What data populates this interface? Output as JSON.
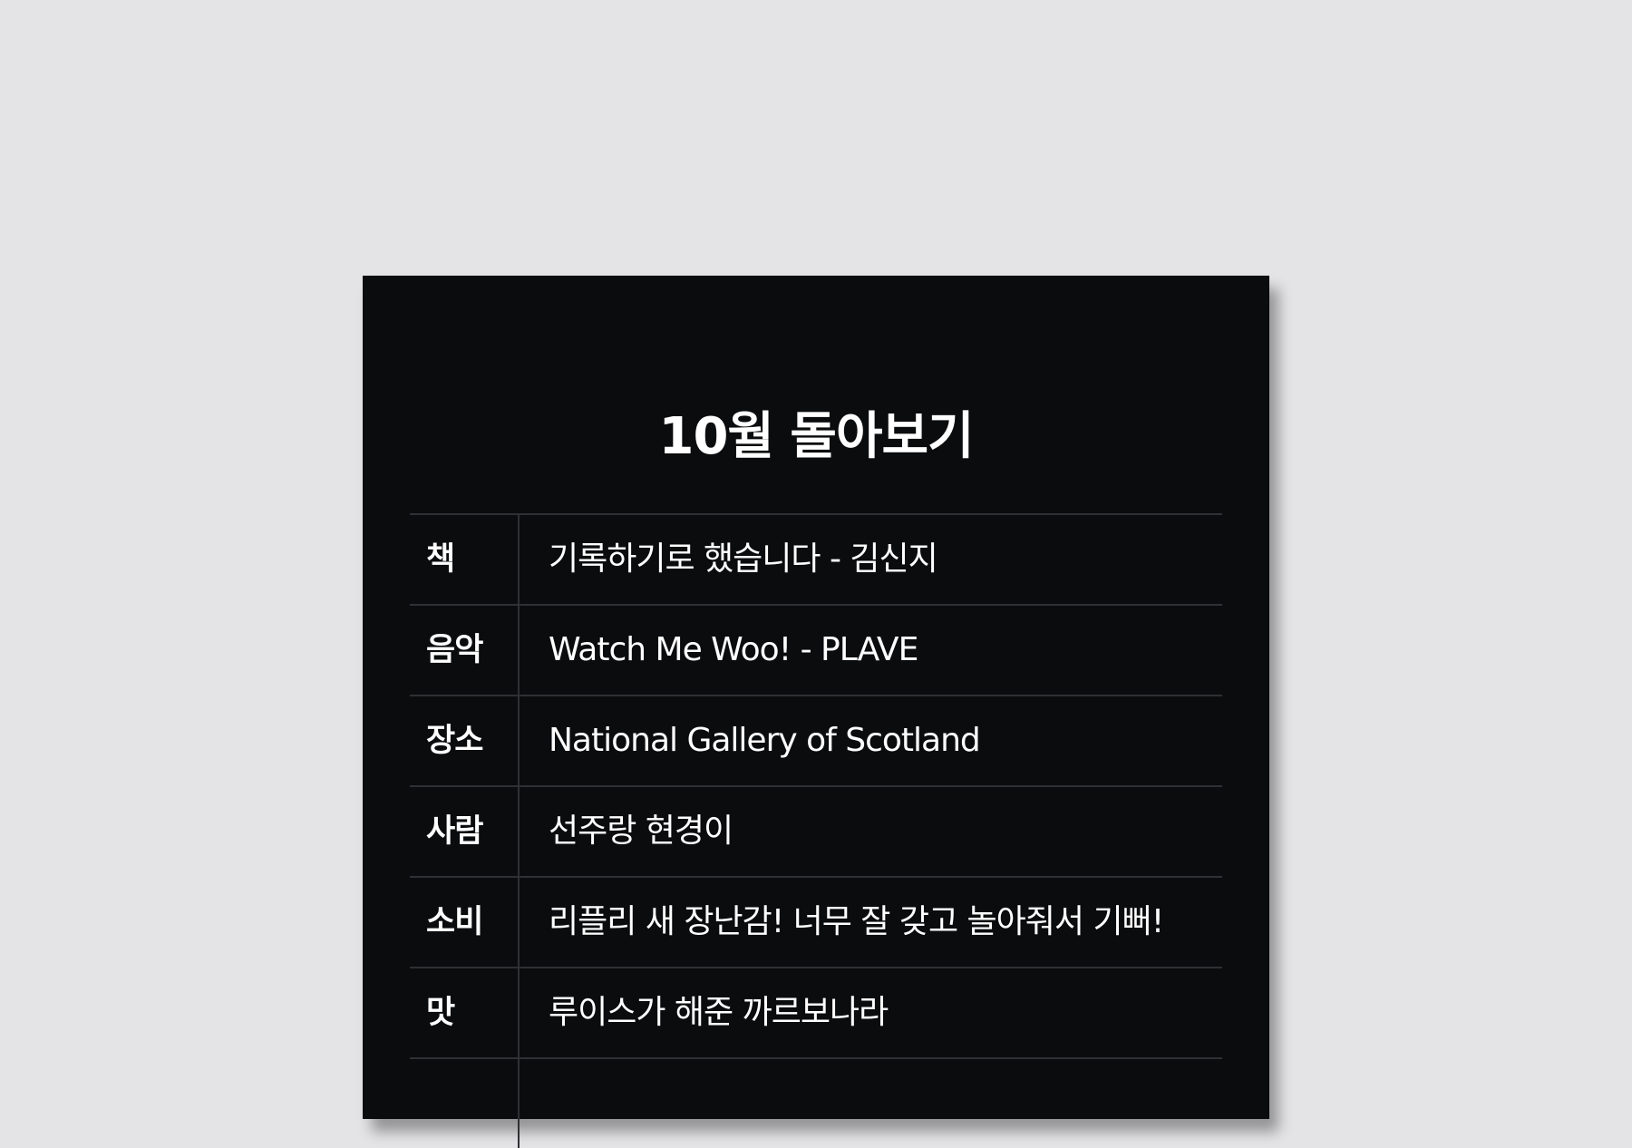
{
  "title": "10월 돌아보기",
  "rows": [
    {
      "category": "책",
      "value": "기록하기로 했습니다 - 김신지"
    },
    {
      "category": "음악",
      "value": "Watch Me Woo! - PLAVE"
    },
    {
      "category": "장소",
      "value": "National Gallery of Scotland"
    },
    {
      "category": "사람",
      "value": "선주랑 현경이"
    },
    {
      "category": "소비",
      "value": "리플리 새 장난감! 너무 잘 갖고 놀아줘서 기뻐!"
    },
    {
      "category": "맛",
      "value": "루이스가 해준 까르보나라"
    }
  ]
}
